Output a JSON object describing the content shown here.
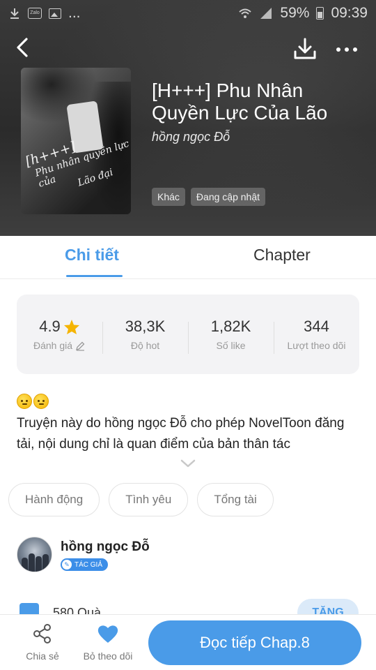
{
  "status_bar": {
    "battery": "59%",
    "time": "09:39",
    "zalo_label": "Zalo",
    "more": "..."
  },
  "book": {
    "title": "[H+++] Phu Nhân Quyền Lực Của Lão",
    "author": "hồng ngọc Đỗ",
    "cover_text": [
      "[h+++]",
      "Phu nhân quyền lực của",
      "Lão đại"
    ],
    "tags": [
      "Khác",
      "Đang cập nhật"
    ]
  },
  "tabs": {
    "details": "Chi tiết",
    "chapter": "Chapter"
  },
  "stats": [
    {
      "value": "4.9",
      "label": "Đánh giá"
    },
    {
      "value": "38,3K",
      "label": "Độ hot"
    },
    {
      "value": "1,82K",
      "label": "Số like"
    },
    {
      "value": "344",
      "label": "Lượt theo dõi"
    }
  ],
  "description": {
    "text": "Truyện này do hồng ngọc Đỗ cho phép NovelToon đăng tải, nội dung chỉ là quan điểm của bản thân tác"
  },
  "genres": [
    "Hành động",
    "Tình yêu",
    "Tổng tài"
  ],
  "author_info": {
    "name": "hồng ngọc Đỗ",
    "badge": "TÁC GIẢ"
  },
  "gifts": {
    "text": "580 Quà",
    "button": "TẶNG"
  },
  "bottom_bar": {
    "share": "Chia sẻ",
    "follow": "Bỏ theo dõi",
    "read": "Đọc tiếp Chap.8"
  },
  "colors": {
    "accent": "#4a9be8",
    "star": "#f5b400"
  }
}
